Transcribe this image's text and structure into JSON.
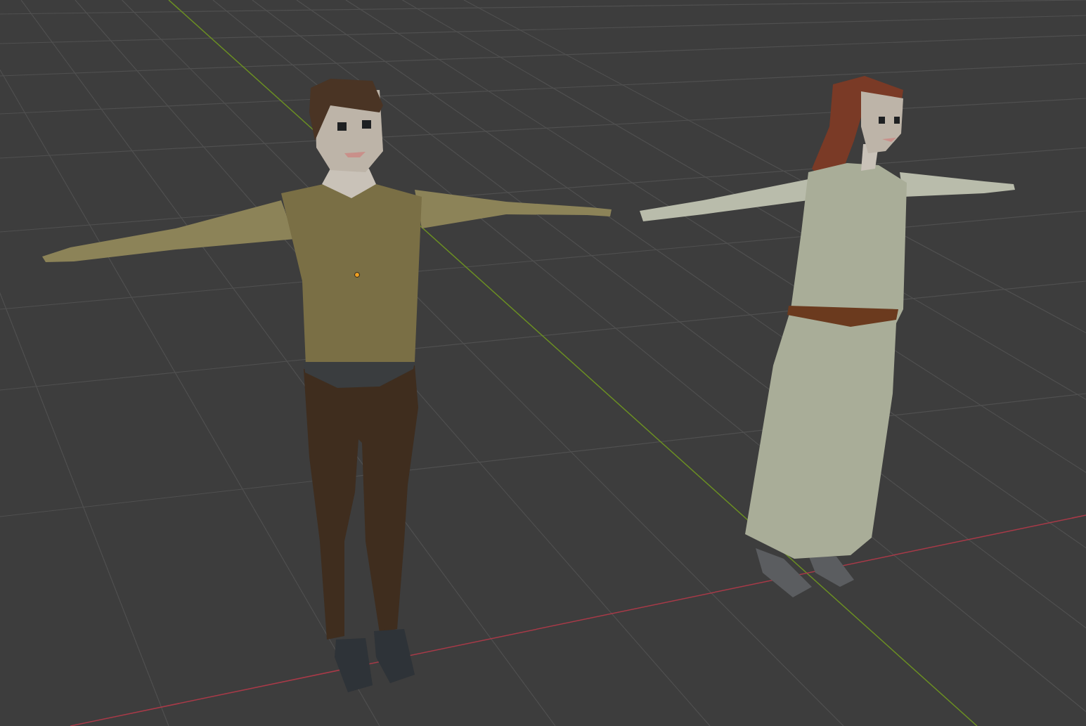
{
  "viewport": {
    "characters": [
      {
        "kind": "man",
        "selected": true
      },
      {
        "kind": "woman",
        "selected": false
      }
    ]
  }
}
